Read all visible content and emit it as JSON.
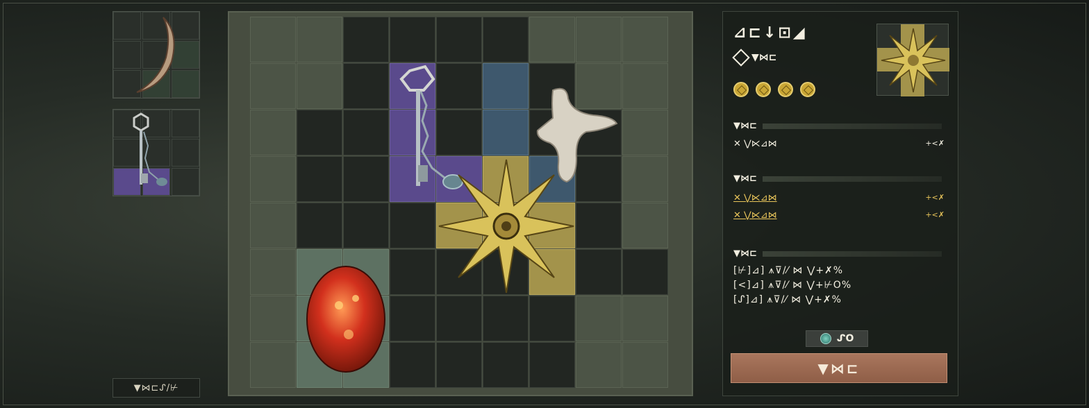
{
  "left_previews": [
    {
      "item": "sickle-claw"
    },
    {
      "item": "chain-key"
    }
  ],
  "bottom_tag": "▼⋈⊏ᔑ/⊬",
  "inventory": {
    "items": [
      "chain-key",
      "bone-fragment",
      "golden-star-relic",
      "red-orb"
    ]
  },
  "panel": {
    "title": "⊿⊏↓⊡◢",
    "subtype_label": "▼⋈⊏",
    "rarity_count": 4,
    "sections": [
      {
        "label": "▼⋈⊏",
        "rows": [
          {
            "text": "✕ ⋁⋉⊿⋈",
            "value": "+<✗",
            "style": "white"
          }
        ]
      },
      {
        "label": "▼⋈⊏",
        "rows": [
          {
            "text": "✕ ⋁⋉⊿⋈",
            "value": "+<✗",
            "style": "gold"
          },
          {
            "text": "✕ ⋁⋉⊿⋈",
            "value": "+<✗",
            "style": "gold"
          }
        ]
      },
      {
        "label": "▼⋈⊏"
      }
    ],
    "list_lines": [
      "[⊬]⊿] ⩚⊽/⁄ ⋈ ⋁+✗%",
      "[<]⊿] ⩚⊽/⁄ ⋈ ⋁+⊬O%",
      "[ᔑ]⊿] ⩚⊽/⁄ ⋈ ⋁+✗%"
    ],
    "cost_value": "ᔑO",
    "action_label": "▼⋈⊏"
  },
  "colors": {
    "purple": "#5a4a8c",
    "blue": "#3e586d",
    "gold": "#a3934b",
    "action": "#9b6a52"
  },
  "icons": [
    "sickle-icon",
    "key-icon",
    "bone-icon",
    "star-relic-icon",
    "orb-icon",
    "coin-icon",
    "gem-icon"
  ]
}
